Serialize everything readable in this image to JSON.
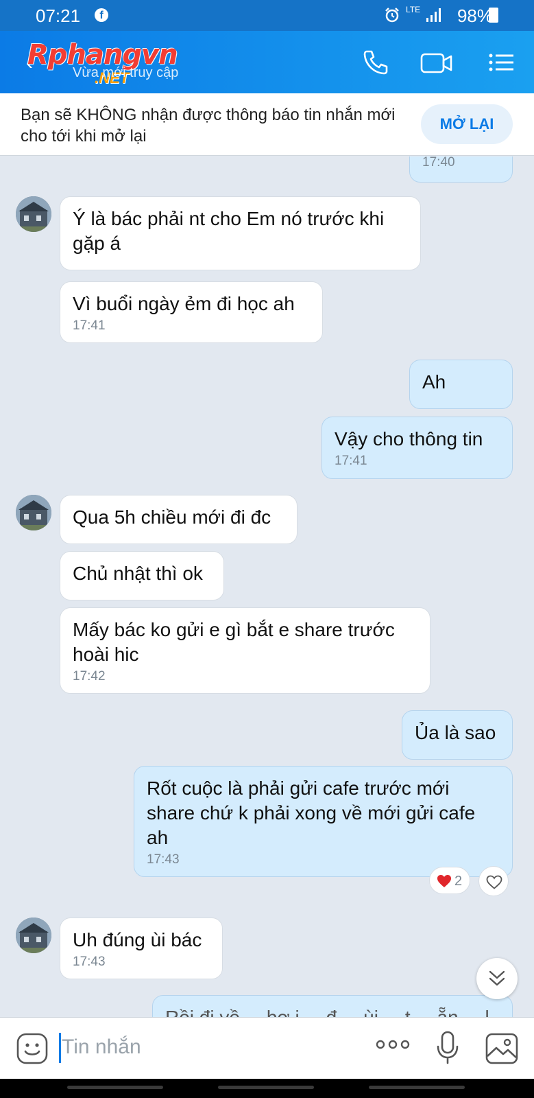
{
  "status_bar": {
    "time": "07:21",
    "battery": "98%",
    "network": "LTE"
  },
  "header": {
    "title": "Rphangvn",
    "watermark_suffix": ".NET",
    "subtitle": "Vừa mới truy cập",
    "back_glyph": "‹"
  },
  "notice": {
    "text": "Bạn sẽ KHÔNG nhận được thông báo tin nhắn mới cho tới khi mở lại",
    "button": "MỞ LẠI"
  },
  "messages": [
    {
      "dir": "out",
      "text": "",
      "time": "17:40"
    },
    {
      "dir": "in",
      "text": "Ý là bác phải nt cho Em nó trước khi gặp á",
      "time": ""
    },
    {
      "dir": "in",
      "text": "Vì buổi ngày ẻm đi học ah",
      "time": "17:41"
    },
    {
      "dir": "out",
      "text": "Ah",
      "time": ""
    },
    {
      "dir": "out",
      "text": "Vậy cho thông tin",
      "time": "17:41"
    },
    {
      "dir": "in",
      "text": "Qua 5h chiều mới đi đc",
      "time": ""
    },
    {
      "dir": "in",
      "text": "Chủ nhật thì ok",
      "time": ""
    },
    {
      "dir": "in",
      "text": "Mấy bác ko gửi e gì bắt e share trước hoài hic",
      "time": "17:42"
    },
    {
      "dir": "out",
      "text": "Ủa là sao",
      "time": ""
    },
    {
      "dir": "out",
      "text": "Rốt cuộc là phải gửi cafe trước mới share chứ k phải xong về mới gửi cafe ah",
      "time": "17:43"
    },
    {
      "dir": "in",
      "text": "Uh đúng ùi bác",
      "time": "17:43"
    },
    {
      "dir": "out",
      "text": "Rồi đi về ... bơ i ... đ ... ùi ... t ... ẵn ... l ... đ ... í ... n ... h ... ỏ",
      "time": ""
    }
  ],
  "reaction": {
    "count": "2"
  },
  "input": {
    "placeholder": "Tin nhắn"
  },
  "colors": {
    "accent": "#0b7be6",
    "header_bg": "#1573c7",
    "outgoing_bubble": "#d4ecfd",
    "chat_bg": "#e2e8f0"
  }
}
